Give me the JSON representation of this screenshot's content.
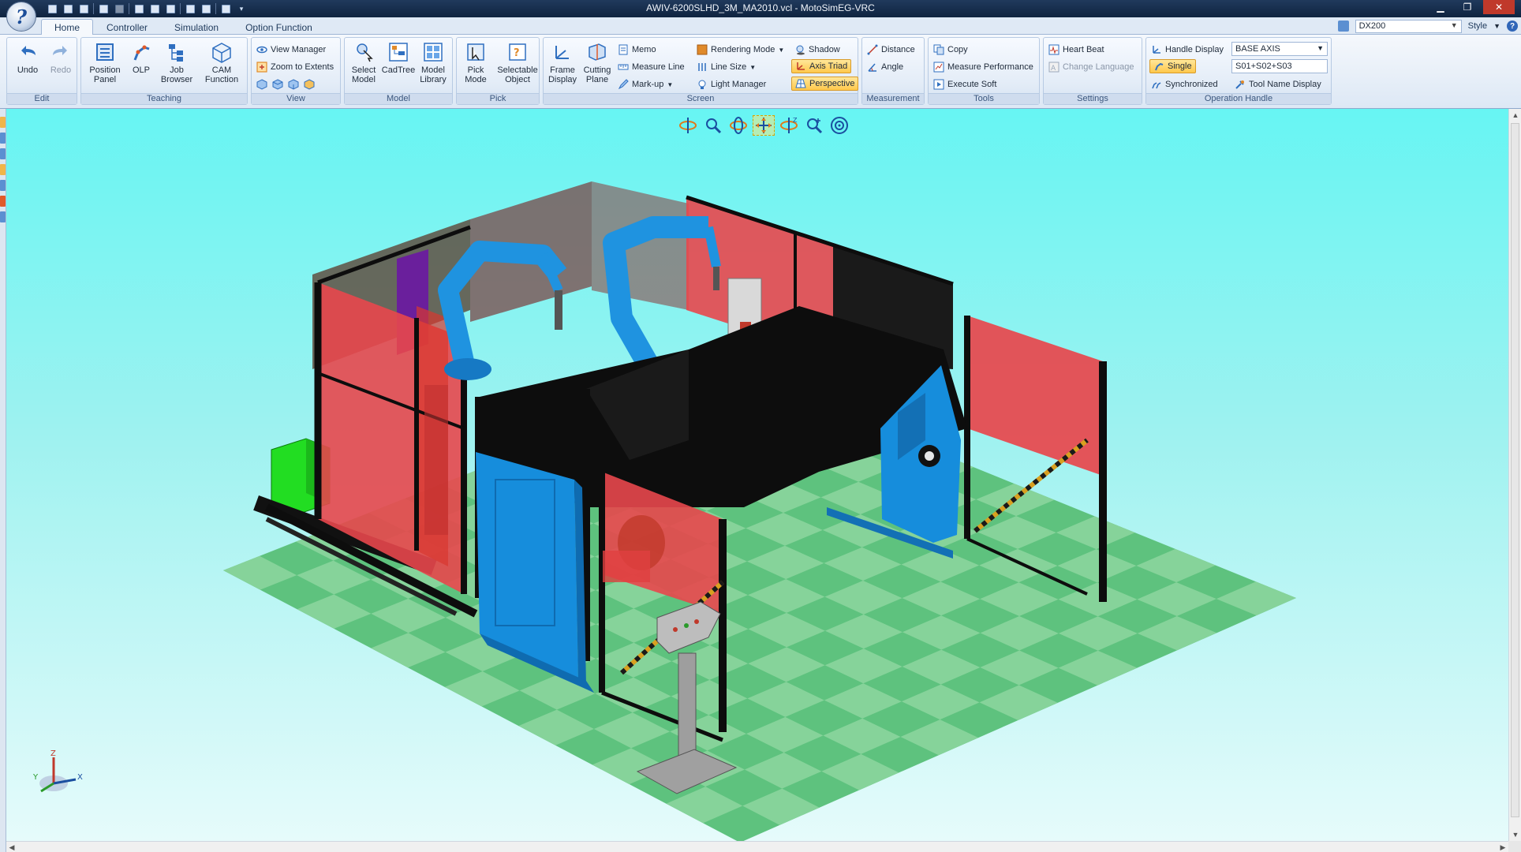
{
  "window": {
    "logo_glyph": "?",
    "title": "AWIV-6200SLHD_3M_MA2010.vcl - MotoSimEG-VRC",
    "controls": [
      "minimize-icon",
      "restore-icon",
      "close-icon"
    ]
  },
  "tabs": [
    {
      "label": "Home",
      "active": true
    },
    {
      "label": "Controller",
      "active": false
    },
    {
      "label": "Simulation",
      "active": false
    },
    {
      "label": "Option Function",
      "active": false
    }
  ],
  "tabbar_right": {
    "controller": "DX200",
    "style_label": "Style",
    "help_glyph": "?"
  },
  "ribbon": {
    "edit": {
      "label": "Edit",
      "undo": "Undo",
      "redo": "Redo"
    },
    "teaching": {
      "label": "Teaching",
      "position_panel_1": "Position",
      "position_panel_2": "Panel",
      "olp": "OLP",
      "job_browser_1": "Job",
      "job_browser_2": "Browser",
      "cam_function_1": "CAM",
      "cam_function_2": "Function"
    },
    "view": {
      "label": "View",
      "view_manager": "View Manager",
      "zoom_to_extents": "Zoom to Extents"
    },
    "model": {
      "label": "Model",
      "select_model_1": "Select",
      "select_model_2": "Model",
      "cadtree_1": "CadTree",
      "cadtree_2": "",
      "model_library_1": "Model",
      "model_library_2": "Library"
    },
    "pick": {
      "label": "Pick",
      "pick_mode_1": "Pick",
      "pick_mode_2": "Mode",
      "selectable_object_1": "Selectable",
      "selectable_object_2": "Object"
    },
    "screen": {
      "label": "Screen",
      "frame_display_1": "Frame",
      "frame_display_2": "Display",
      "cutting_plane_1": "Cutting",
      "cutting_plane_2": "Plane",
      "memo": "Memo",
      "measure_line": "Measure Line",
      "mark_up": "Mark-up",
      "rendering_mode": "Rendering Mode",
      "line_size": "Line Size",
      "light_manager": "Light Manager",
      "shadow": "Shadow",
      "axis_triad": "Axis Triad",
      "perspective": "Perspective"
    },
    "measurement": {
      "label": "Measurement",
      "distance": "Distance",
      "angle": "Angle"
    },
    "tools": {
      "label": "Tools",
      "copy": "Copy",
      "measure_performance": "Measure Performance",
      "execute_soft": "Execute Soft"
    },
    "settings": {
      "label": "Settings",
      "heart_beat": "Heart Beat",
      "change_language": "Change Language"
    },
    "operation_handle": {
      "label": "Operation Handle",
      "handle_display": "Handle Display",
      "handle_display_value": "BASE AXIS",
      "single": "Single",
      "synchronized": "Synchronized",
      "axes_value": "S01+S02+S03",
      "tool_name_display": "Tool Name Display"
    }
  },
  "viewport": {
    "nav_tools": [
      "rotate-icon",
      "zoom-window-icon",
      "rotate-xy-icon",
      "pan-icon",
      "rotate-z-icon",
      "zoom-icon",
      "fit-target-icon"
    ],
    "triad": {
      "x": "X",
      "y": "Y",
      "z": "Z"
    },
    "colors": {
      "floor_a": "#5ec27e",
      "floor_b": "#86d39a",
      "fence_red": "#e8474c",
      "robot_blue": "#1f93e0",
      "frame_black": "#0d0d0d",
      "positioner_blue": "#168ddc",
      "controller_green": "#22dd22",
      "purple": "#6a1f9c"
    }
  }
}
